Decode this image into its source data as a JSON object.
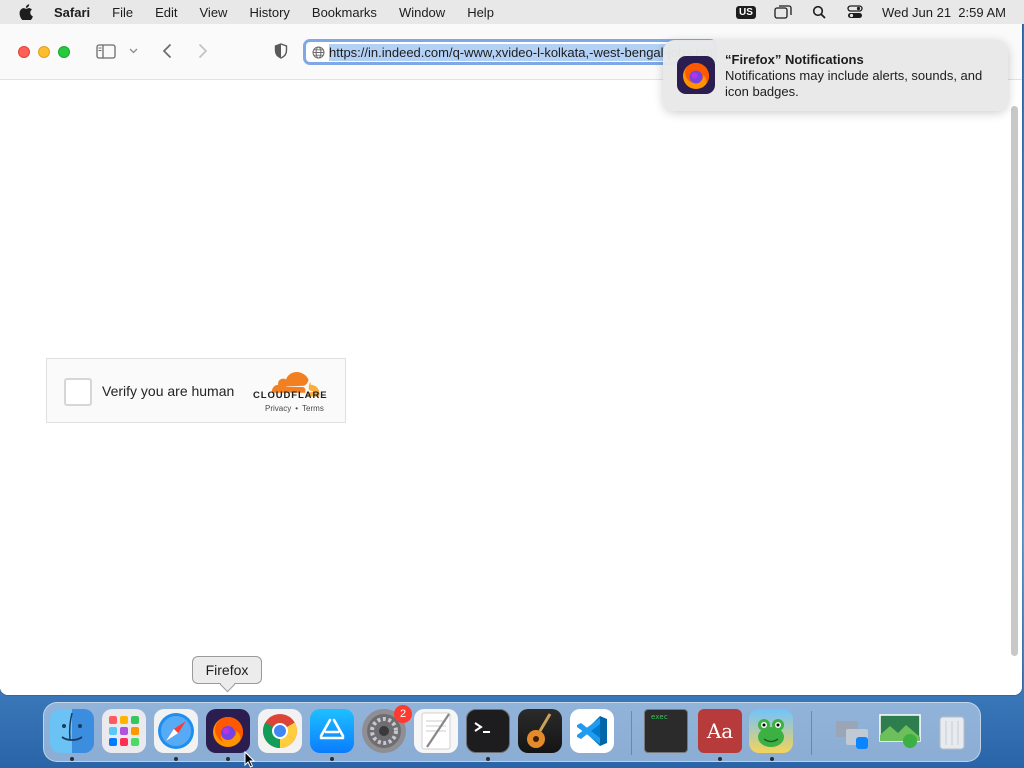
{
  "menubar": {
    "app_name": "Safari",
    "items": [
      "File",
      "Edit",
      "View",
      "History",
      "Bookmarks",
      "Window",
      "Help"
    ],
    "input_source": "US",
    "datetime": "Wed Jun 21  2:59 AM",
    "icons": [
      "apple-icon",
      "window-icon",
      "spotlight-search-icon",
      "control-center-icon"
    ]
  },
  "browser": {
    "url": "https://in.indeed.com/q-www,xvideo-l-kolkata,-west-bengal-jobs.html",
    "toolbar_icons": [
      "sidebar-icon",
      "chevron-down-icon",
      "back-icon",
      "forward-icon",
      "shield-icon",
      "globe-icon"
    ]
  },
  "captcha": {
    "label": "Verify you are human",
    "brand": "CLOUDFLARE",
    "privacy_link": "Privacy",
    "separator": "•",
    "terms_link": "Terms",
    "brand_color": "#f38020"
  },
  "notification": {
    "title": "“Firefox” Notifications",
    "body": "Notifications may include alerts, sounds, and icon badges."
  },
  "dock": {
    "tooltip": "Firefox",
    "apps": [
      {
        "name": "Finder",
        "running": true
      },
      {
        "name": "Launchpad",
        "running": false
      },
      {
        "name": "Safari",
        "running": true
      },
      {
        "name": "Firefox",
        "running": true
      },
      {
        "name": "Google Chrome",
        "running": false
      },
      {
        "name": "App Store",
        "running": true
      },
      {
        "name": "System Settings",
        "running": false,
        "badge": "2"
      },
      {
        "name": "TextEdit",
        "running": false
      },
      {
        "name": "Terminal",
        "running": true
      },
      {
        "name": "GarageBand",
        "running": false
      },
      {
        "name": "Visual Studio Code",
        "running": false
      },
      {
        "name": "Exec Console",
        "running": false
      },
      {
        "name": "Dictionary",
        "running": true
      },
      {
        "name": "Frogger Game",
        "running": true
      },
      {
        "name": "Applications Stack",
        "running": false
      },
      {
        "name": "Downloads Stack",
        "running": false
      },
      {
        "name": "Trash",
        "running": false
      }
    ],
    "exec_label": "exec",
    "dictionary_label": "Aa"
  }
}
